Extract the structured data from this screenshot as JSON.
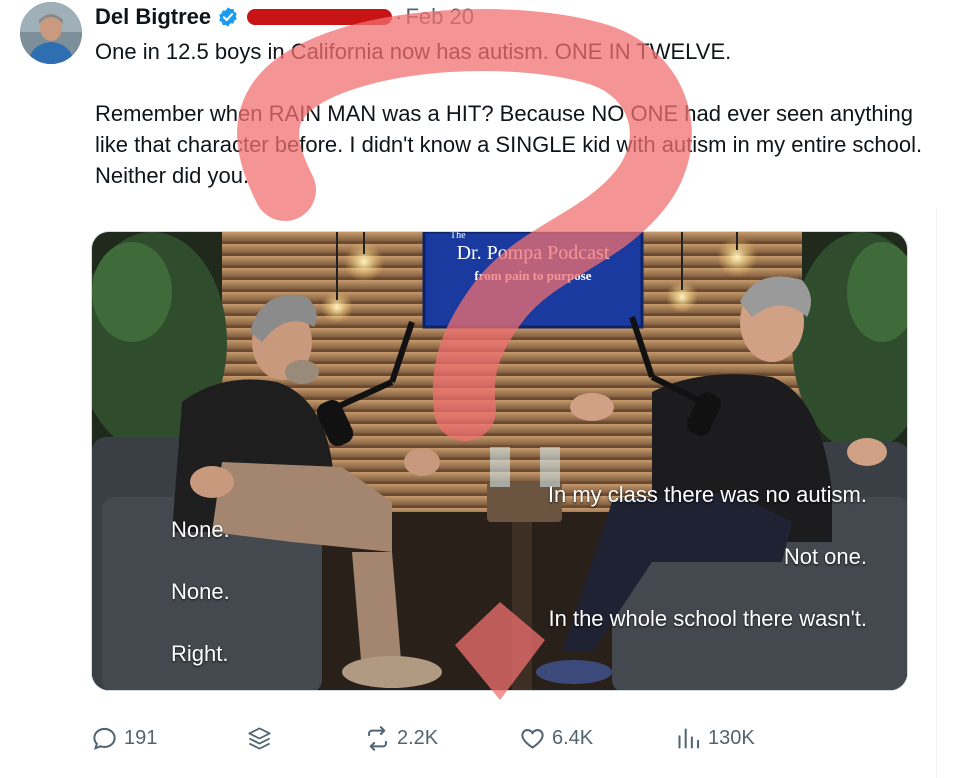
{
  "author": {
    "name": "Del Bigtree",
    "date": "Feb 20",
    "separator": "·"
  },
  "tweet": {
    "paragraph1": "One in 12.5 boys in California now has autism. ONE IN TWELVE.",
    "paragraph2": "Remember when RAIN MAN was a HIT? Because NO ONE had ever seen anything like that character before. I didn't know a SINGLE kid with autism in my entire school. Neither did you."
  },
  "media": {
    "screen_small": "The",
    "screen_title": "Dr. Pompa Podcast",
    "screen_sub": "from pain to purpose",
    "captions": {
      "left1": "None.",
      "left2": "None.",
      "left3": "Right.",
      "right1": "In my class there was no autism.",
      "right2": "Not one.",
      "right3": "In the whole school there wasn't."
    }
  },
  "actions": {
    "replies": "191",
    "reposts": "2.2K",
    "likes": "6.4K",
    "views": "130K"
  },
  "colors": {
    "text": "#0f1419",
    "muted": "#536471",
    "verified": "#1d9bf0",
    "redaction": "#c81414",
    "question_mark_overlay": "#f07070"
  }
}
